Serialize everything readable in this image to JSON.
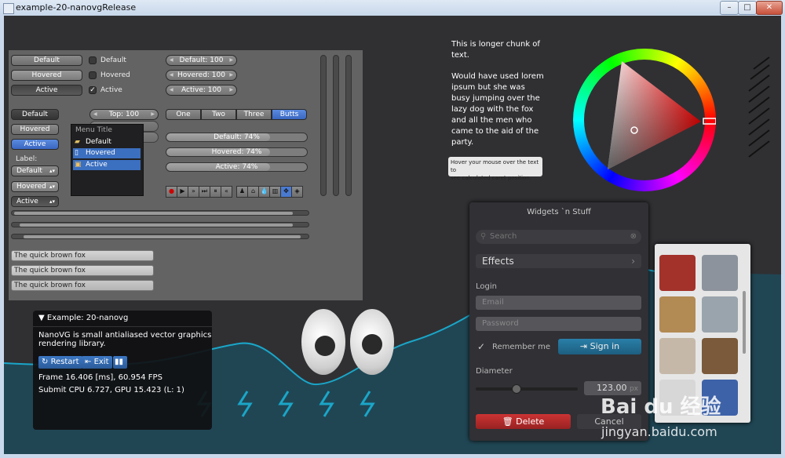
{
  "window": {
    "title": "example-20-nanovgRelease",
    "min": "–",
    "max": "□",
    "close": "✕"
  },
  "panel": {
    "buttons": [
      "Default",
      "Hovered",
      "Active"
    ],
    "checkboxes": [
      "Default",
      "Hovered",
      "Active"
    ],
    "pills": [
      "Default: 100",
      "Hovered: 100",
      "Active: 100"
    ],
    "buttons2": [
      "Default",
      "Hovered",
      "Active"
    ],
    "stepper": "Top: 100",
    "segments": [
      "One",
      "Two",
      "Three",
      "Butts"
    ],
    "progress": [
      {
        "label": "Default: 74%",
        "value": 0.74
      },
      {
        "label": "Hovered: 74%",
        "value": 0.74
      },
      {
        "label": "Active: 74%",
        "value": 0.74
      }
    ],
    "label": "Label:",
    "dropdowns": [
      "Default",
      "Hovered",
      "Active"
    ],
    "fields": [
      "The quick brown fox",
      "The quick brown fox",
      "The quick brown fox"
    ],
    "menu": {
      "title": "Menu Title",
      "items": [
        "Default",
        "Hovered",
        "Active"
      ]
    }
  },
  "longtext": {
    "para1": [
      "This is longer chunk of",
      "text."
    ],
    "para2": [
      "Would have used lorem",
      "ipsum but she    was",
      "busy jumping over the",
      "lazy dog with the fox",
      "and all the men who",
      "came to the aid of the",
      "party."
    ],
    "tooltip": [
      "Hover your mouse over the text to",
      "see calculated caret position."
    ]
  },
  "widgets": {
    "title": "Widgets `n Stuff",
    "search_placeholder": "Search",
    "effects": "Effects",
    "login_label": "Login",
    "email_placeholder": "Email",
    "password_placeholder": "Password",
    "remember": "Remember me",
    "signin": "Sign in",
    "diameter": "Diameter",
    "diameter_value": "123.00",
    "unit": "px",
    "delete": "Delete",
    "cancel": "Cancel"
  },
  "example": {
    "title": "Example: 20-nanovg",
    "desc": [
      "NanoVG is small antialiased vector graphics",
      "rendering library."
    ],
    "restart": "Restart",
    "exit": "Exit",
    "frame": "Frame 16.406 [ms], 60.954 FPS",
    "submit": "Submit CPU 6.727, GPU 15.423 (L: 1)"
  },
  "watermark": {
    "brand": "Bai du 经验",
    "url": "jingyan.baidu.com"
  }
}
